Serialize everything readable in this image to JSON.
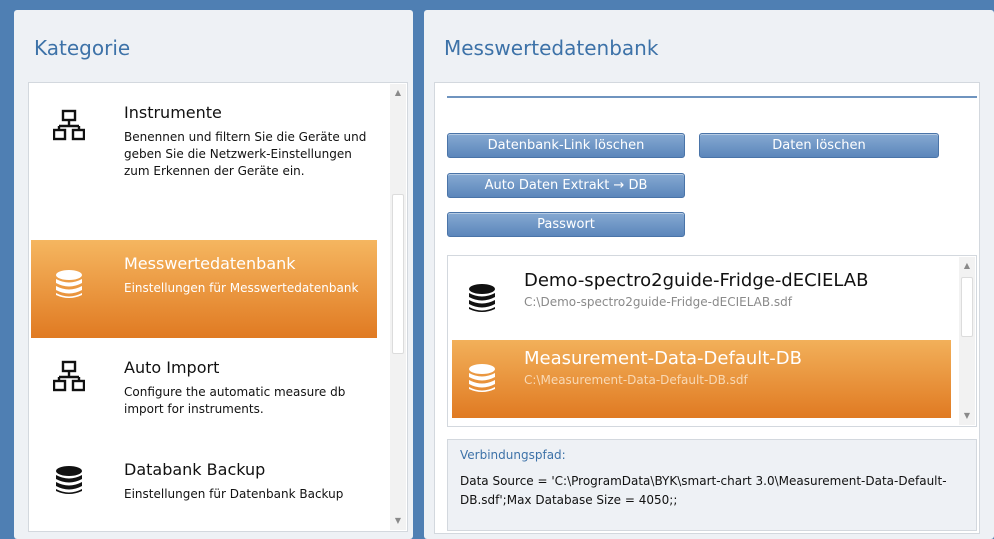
{
  "left_panel": {
    "title": "Kategorie",
    "items": [
      {
        "title": "Instrumente",
        "desc": "Benennen und filtern Sie die Geräte und geben Sie die Netzwerk-Einstellungen zum Erkennen der Geräte ein.",
        "icon": "network-icon"
      },
      {
        "title": "Messwertedatenbank",
        "desc": "Einstellungen für Messwertedatenbank",
        "icon": "database-icon"
      },
      {
        "title": "Auto Import",
        "desc": "Configure the automatic measure db import for instruments.",
        "icon": "network-icon"
      },
      {
        "title": "Databank Backup",
        "desc": "Einstellungen für Datenbank Backup",
        "icon": "database-icon"
      }
    ],
    "selected_index": 1
  },
  "right_panel": {
    "title": "Messwertedatenbank",
    "buttons": {
      "delete_link": "Datenbank-Link löschen",
      "delete_data": "Daten löschen",
      "auto_extract": "Auto Daten Extrakt → DB",
      "password": "Passwort"
    },
    "databases": [
      {
        "name": "Demo-spectro2guide-Fridge-dECIELAB",
        "path": "C:\\Demo-spectro2guide-Fridge-dECIELAB.sdf"
      },
      {
        "name": "Measurement-Data-Default-DB",
        "path": "C:\\Measurement-Data-Default-DB.sdf"
      }
    ],
    "selected_db_index": 1,
    "connection": {
      "label": "Verbindungspfad:",
      "value": "Data Source = 'C:\\ProgramData\\BYK\\smart-chart 3.0\\Measurement-Data-Default-DB.sdf';Max Database Size = 4050;;"
    }
  },
  "colors": {
    "window_bg": "#4f7fb3",
    "accent_blue": "#3d72a8",
    "selection_orange": "#e8892e",
    "button_blue": "#6f97c7"
  }
}
